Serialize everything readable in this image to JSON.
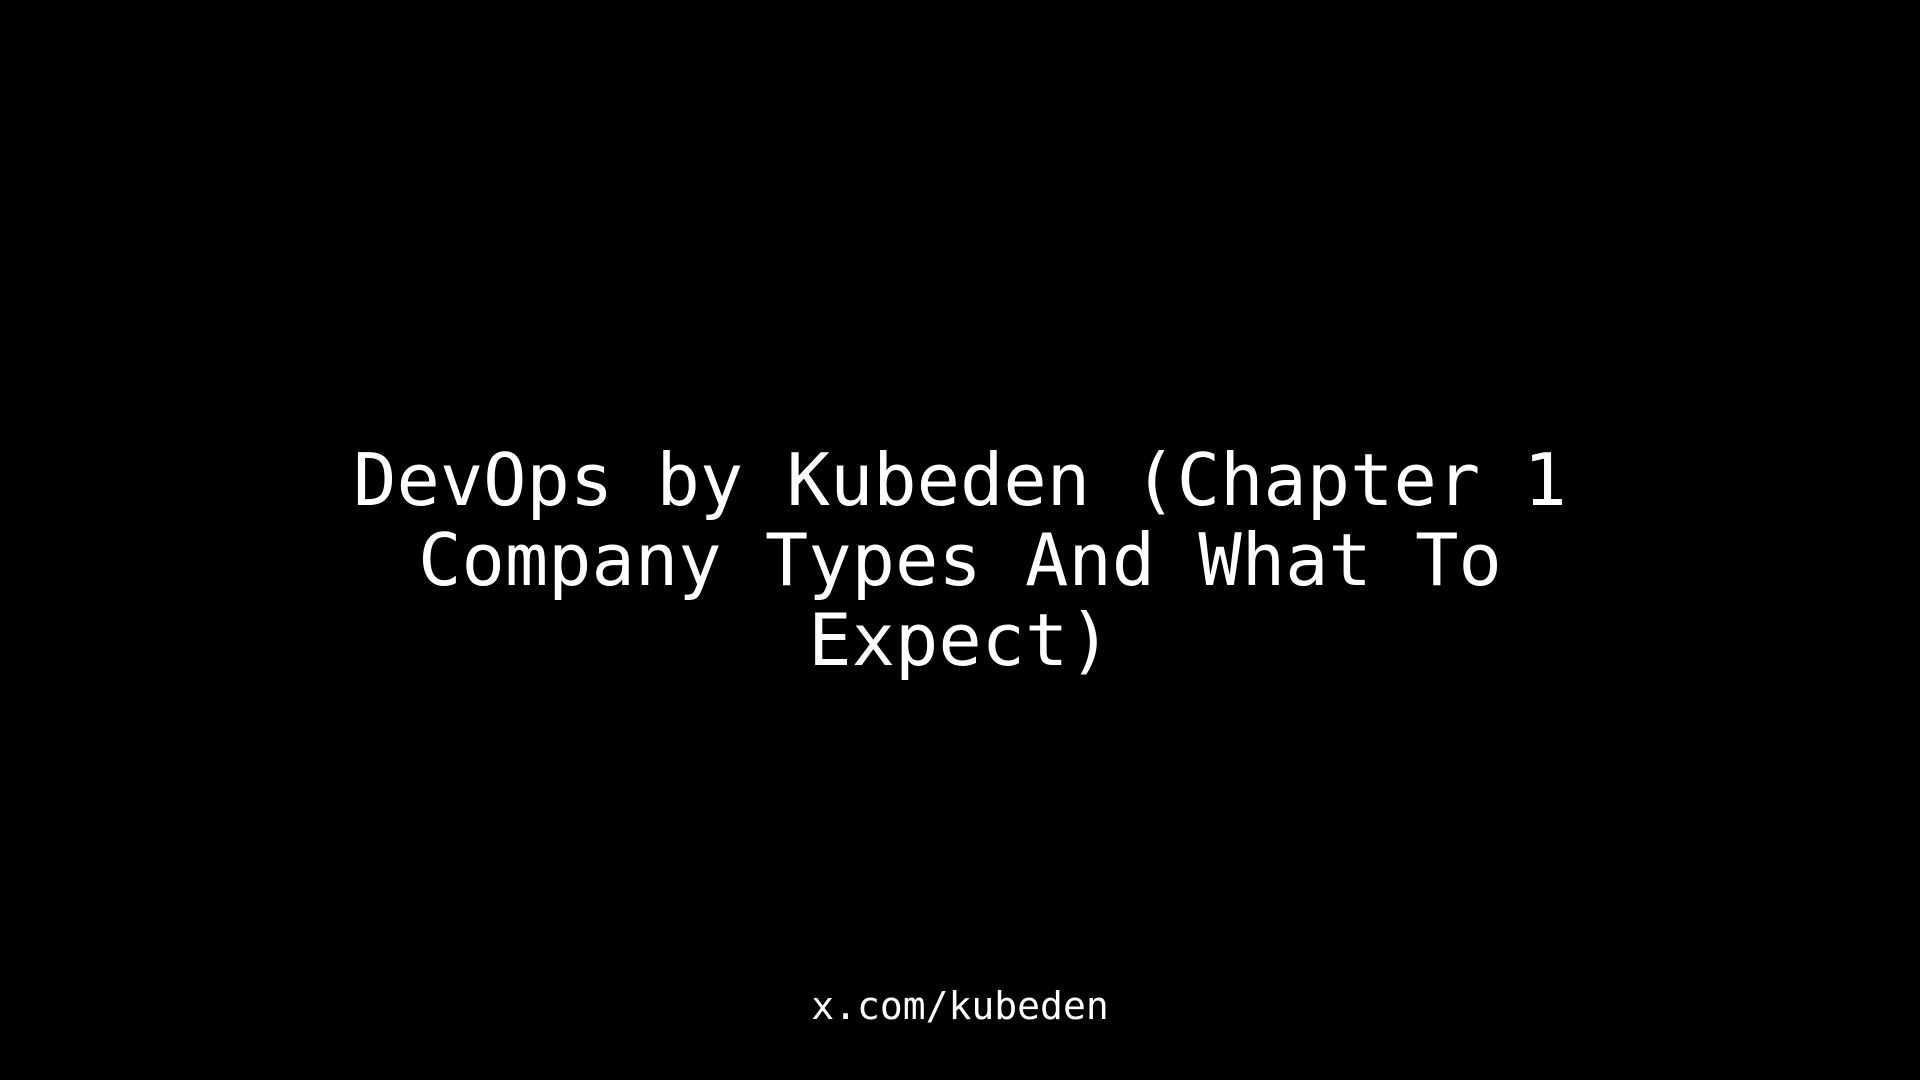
{
  "title": {
    "lines": [
      "DevOps by Kubeden (Chapter 1",
      "Company Types And What To",
      "Expect)"
    ]
  },
  "footer": {
    "handle": "x.com/kubeden"
  },
  "colors": {
    "background": "#000000",
    "text": "#ffffff"
  }
}
